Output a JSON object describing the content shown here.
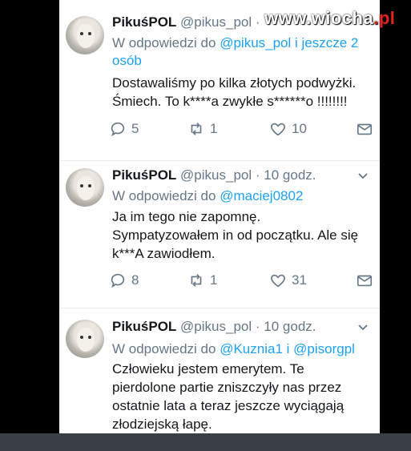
{
  "watermark": {
    "main": "www.wiocha",
    "ext": ".pl"
  },
  "tweets": [
    {
      "name": "PikuśPOL",
      "handle": "@pikus_pol",
      "time": "",
      "reply_prefix": "W odpowiedzi do",
      "reply_to": "@pikus_pol i jeszcze 2",
      "reply_to_2": "osób",
      "text_lines": [
        "Dostawaliśmy po kilka złotych podwyżki.",
        "Śmiech. To k****a zwykłe s******o !!!!!!!!"
      ],
      "replies": "5",
      "retweets": "1",
      "likes": "10"
    },
    {
      "name": "PikuśPOL",
      "handle": "@pikus_pol",
      "time": "10 godz.",
      "reply_prefix": "W odpowiedzi do",
      "reply_to": "@maciej0802",
      "text_lines": [
        "Ja im tego nie zapomnę.",
        "Sympatyzowałem in od początku. Ale się",
        "k***A zawiodłem."
      ],
      "replies": "8",
      "retweets": "1",
      "likes": "31"
    },
    {
      "name": "PikuśPOL",
      "handle": "@pikus_pol",
      "time": "10 godz.",
      "reply_prefix": "W odpowiedzi do",
      "reply_to": "@Kuznia1",
      "reply_joiner": "i",
      "reply_to_b": "@pisorgpl",
      "text_lines": [
        "Człowieku jestem emerytem. Te",
        "pierdolone partie zniszczyły nas przez",
        "ostatnie lata a teraz jeszcze wyciągają",
        "złodziejską łapę."
      ]
    }
  ]
}
